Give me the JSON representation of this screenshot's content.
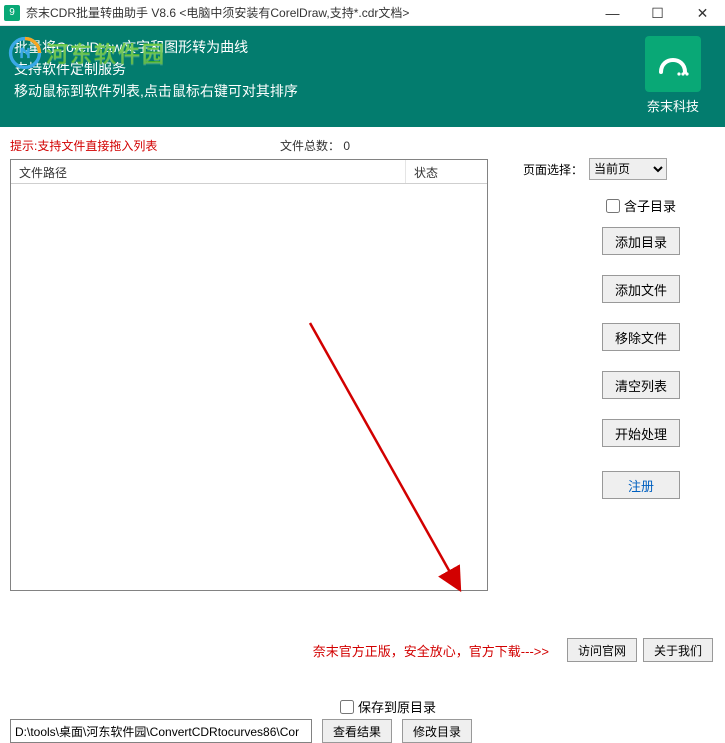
{
  "titlebar": {
    "title": "奈末CDR批量转曲助手 V8.6   <电脑中须安装有CorelDraw,支持*.cdr文档>"
  },
  "header": {
    "line1": "批量将CorelDraw文字和图形转为曲线",
    "line2": "支持软件定制服务",
    "line3": "移动鼠标到软件列表,点击鼠标右键可对其排序",
    "logo_text": "奈末科技"
  },
  "tip": "提示:支持文件直接拖入列表",
  "file_count_label": "文件总数：",
  "file_count_value": "0",
  "page_select": {
    "label": "页面选择：",
    "selected": "当前页",
    "options": [
      "当前页"
    ]
  },
  "list": {
    "col_path": "文件路径",
    "col_status": "状态"
  },
  "side": {
    "include_subdir": "含子目录",
    "add_dir": "添加目录",
    "add_file": "添加文件",
    "remove_file": "移除文件",
    "clear_list": "清空列表",
    "start": "开始处理",
    "register": "注册"
  },
  "bottom": {
    "save_orig": "保存到原目录",
    "path_value": "D:\\tools\\桌面\\河东软件园\\ConvertCDRtocurves86\\Cor",
    "view_result": "查看结果",
    "change_dir": "修改目录"
  },
  "footer": {
    "text": "奈末官方正版，安全放心，官方下载--->>",
    "visit": "访问官网",
    "about": "关于我们"
  }
}
